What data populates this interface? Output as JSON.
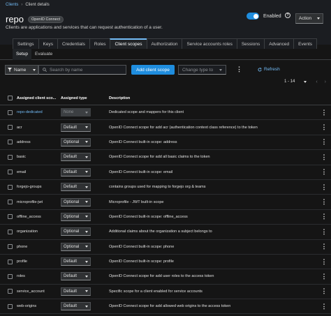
{
  "breadcrumb": {
    "root": "Clients",
    "current": "Client details"
  },
  "header": {
    "title": "repo",
    "badge": "OpenID Connect",
    "subtitle": "Clients are applications and services that can request authentication of a user.",
    "enabled_label": "Enabled",
    "enabled": true,
    "action_label": "Action"
  },
  "tabs": [
    "Settings",
    "Keys",
    "Credentials",
    "Roles",
    "Client scopes",
    "Authorization",
    "Service accounts roles",
    "Sessions",
    "Advanced",
    "Events"
  ],
  "subtabs": [
    "Setup",
    "Evaluate"
  ],
  "toolbar": {
    "filter_label": "Name",
    "search_placeholder": "Search by name",
    "add_button": "Add client scope",
    "change_type": "Change type to",
    "refresh": "Refresh",
    "pagination": "1 - 14"
  },
  "table": {
    "headers": {
      "name": "Assigned client sco...",
      "type": "Assigned type",
      "description": "Description"
    },
    "rows": [
      {
        "name": "repo-dedicated",
        "type": "None",
        "description": "Dedicated scope and mappers for this client"
      },
      {
        "name": "acr",
        "type": "Default",
        "description": "OpenID Connect scope for add acr (authentication context class reference) to the token"
      },
      {
        "name": "address",
        "type": "Optional",
        "description": "OpenID Connect built-in scope: address"
      },
      {
        "name": "basic",
        "type": "Default",
        "description": "OpenID Connect scope for add all basic claims to the token"
      },
      {
        "name": "email",
        "type": "Default",
        "description": "OpenID Connect built-in scope: email"
      },
      {
        "name": "forgejo-groups",
        "type": "Default",
        "description": "contains groups used for mapping to forgejo org & teams"
      },
      {
        "name": "microprofile-jwt",
        "type": "Optional",
        "description": "Microprofile - JWT built-in scope"
      },
      {
        "name": "offline_access",
        "type": "Optional",
        "description": "OpenID Connect built-in scope: offline_access"
      },
      {
        "name": "organization",
        "type": "Optional",
        "description": "Additional claims about the organization a subject belongs to"
      },
      {
        "name": "phone",
        "type": "Optional",
        "description": "OpenID Connect built-in scope: phone"
      },
      {
        "name": "profile",
        "type": "Default",
        "description": "OpenID Connect built-in scope: profile"
      },
      {
        "name": "roles",
        "type": "Default",
        "description": "OpenID Connect scope for add user roles to the access token"
      },
      {
        "name": "service_account",
        "type": "Default",
        "description": "Specific scope for a client enabled for service accounts"
      },
      {
        "name": "web-origins",
        "type": "Default",
        "description": "OpenID Connect scope for add allowed web origins to the access token"
      }
    ]
  },
  "colors": {
    "accent": "#1f8dde",
    "link": "#73bcf7",
    "background": "#151515"
  }
}
